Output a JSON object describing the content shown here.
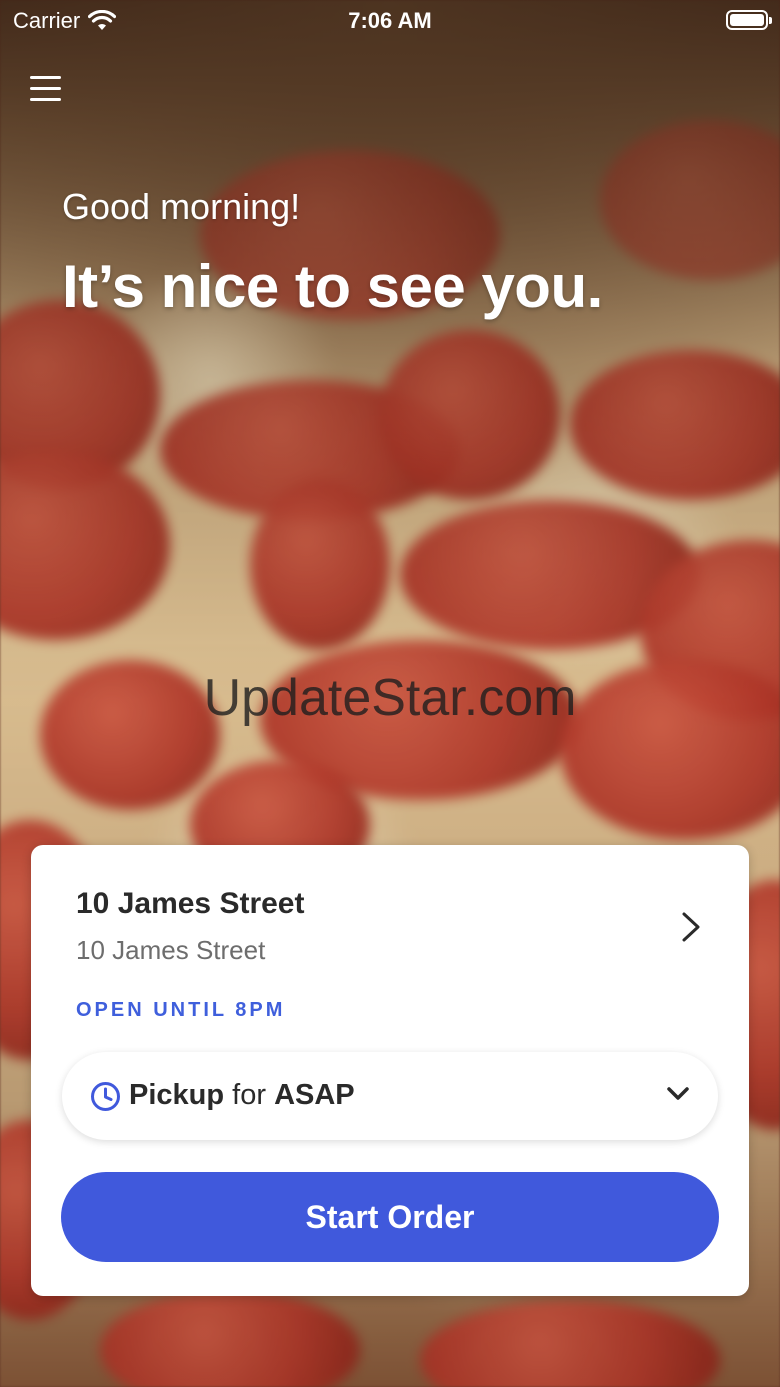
{
  "status_bar": {
    "carrier": "Carrier",
    "time": "7:06 AM"
  },
  "hero": {
    "greeting": "Good morning!",
    "headline": "It’s nice to see you.",
    "watermark": "UpdateStar.com"
  },
  "location": {
    "name": "10 James Street",
    "address": "10 James Street",
    "hours": "OPEN UNTIL 8PM"
  },
  "order_mode": {
    "mode": "Pickup",
    "connector": "for",
    "time": "ASAP"
  },
  "actions": {
    "start_order": "Start Order"
  },
  "colors": {
    "accent": "#4059dc",
    "hours_text": "#3f5fdc"
  },
  "icons": [
    "wifi-icon",
    "battery-icon",
    "menu-icon",
    "chevron-right-icon",
    "clock-icon",
    "chevron-down-icon"
  ]
}
